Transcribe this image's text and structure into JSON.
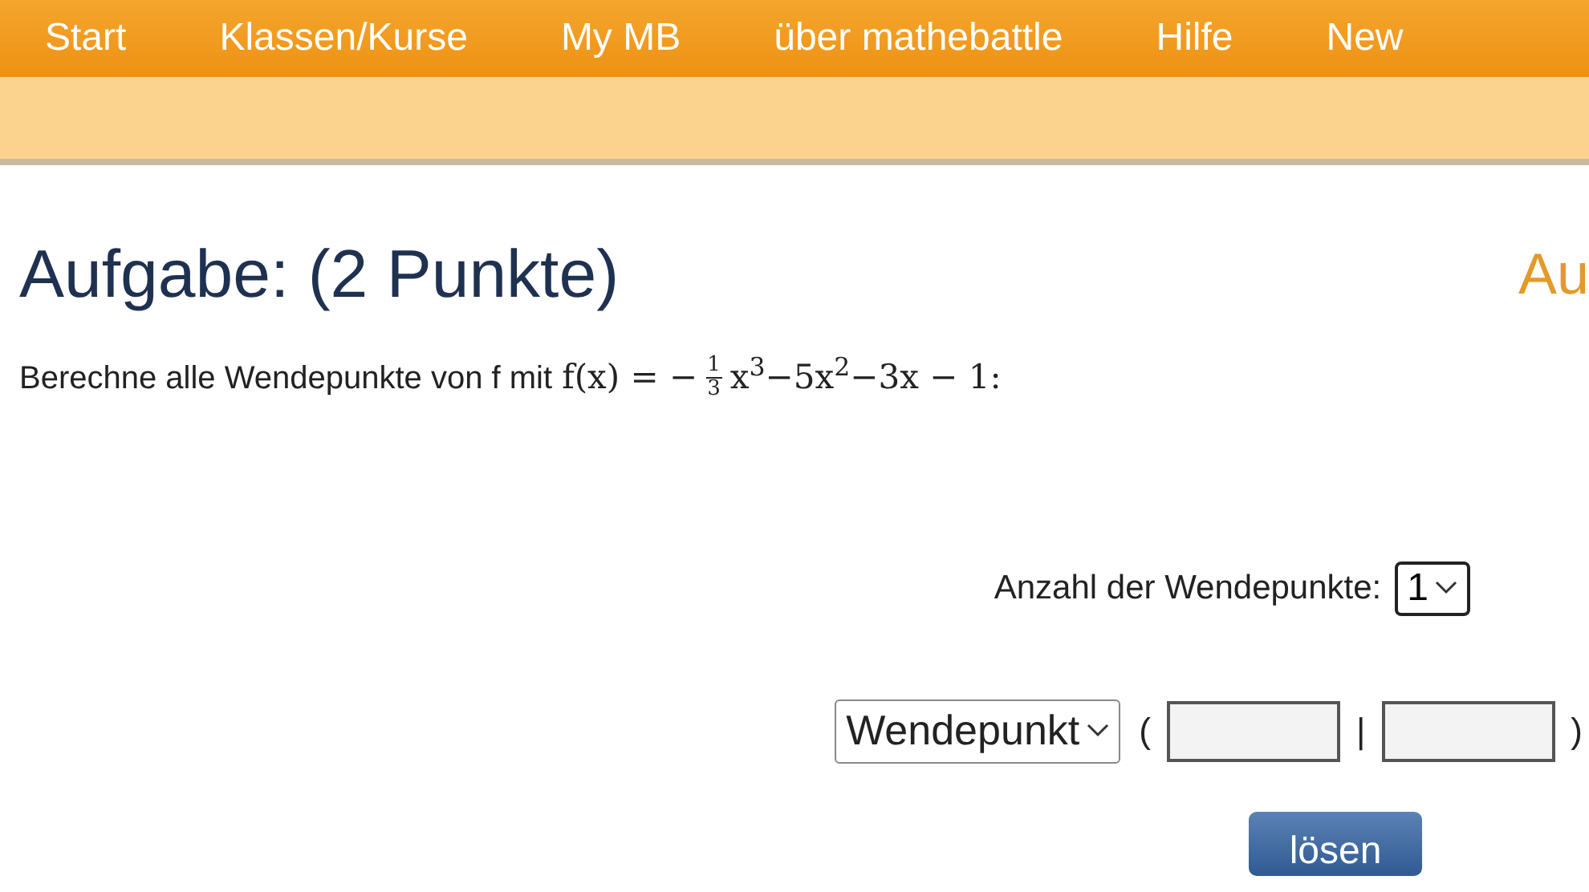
{
  "nav": {
    "items": [
      {
        "label": "Start"
      },
      {
        "label": "Klassen/Kurse"
      },
      {
        "label": "My MB"
      },
      {
        "label": "über mathebattle"
      },
      {
        "label": "Hilfe"
      },
      {
        "label": "New"
      }
    ]
  },
  "heading": "Aufgabe: (2 Punkte)",
  "side_heading": "Au",
  "task": {
    "text": "Berechne alle Wendepunkte von f mit",
    "formula_start": "f(x) = −",
    "numerator": "1",
    "denominator": "3",
    "formula_end": "x$^{3}$−5x$^{2}$−3x − 1:"
  },
  "count_field": {
    "label": "Anzahl der Wendepunkte:",
    "value": "1"
  },
  "point_row": {
    "type_value": "Wendepunkt",
    "open": "(",
    "separator": "|",
    "close": ")"
  },
  "submit": "lösen"
}
